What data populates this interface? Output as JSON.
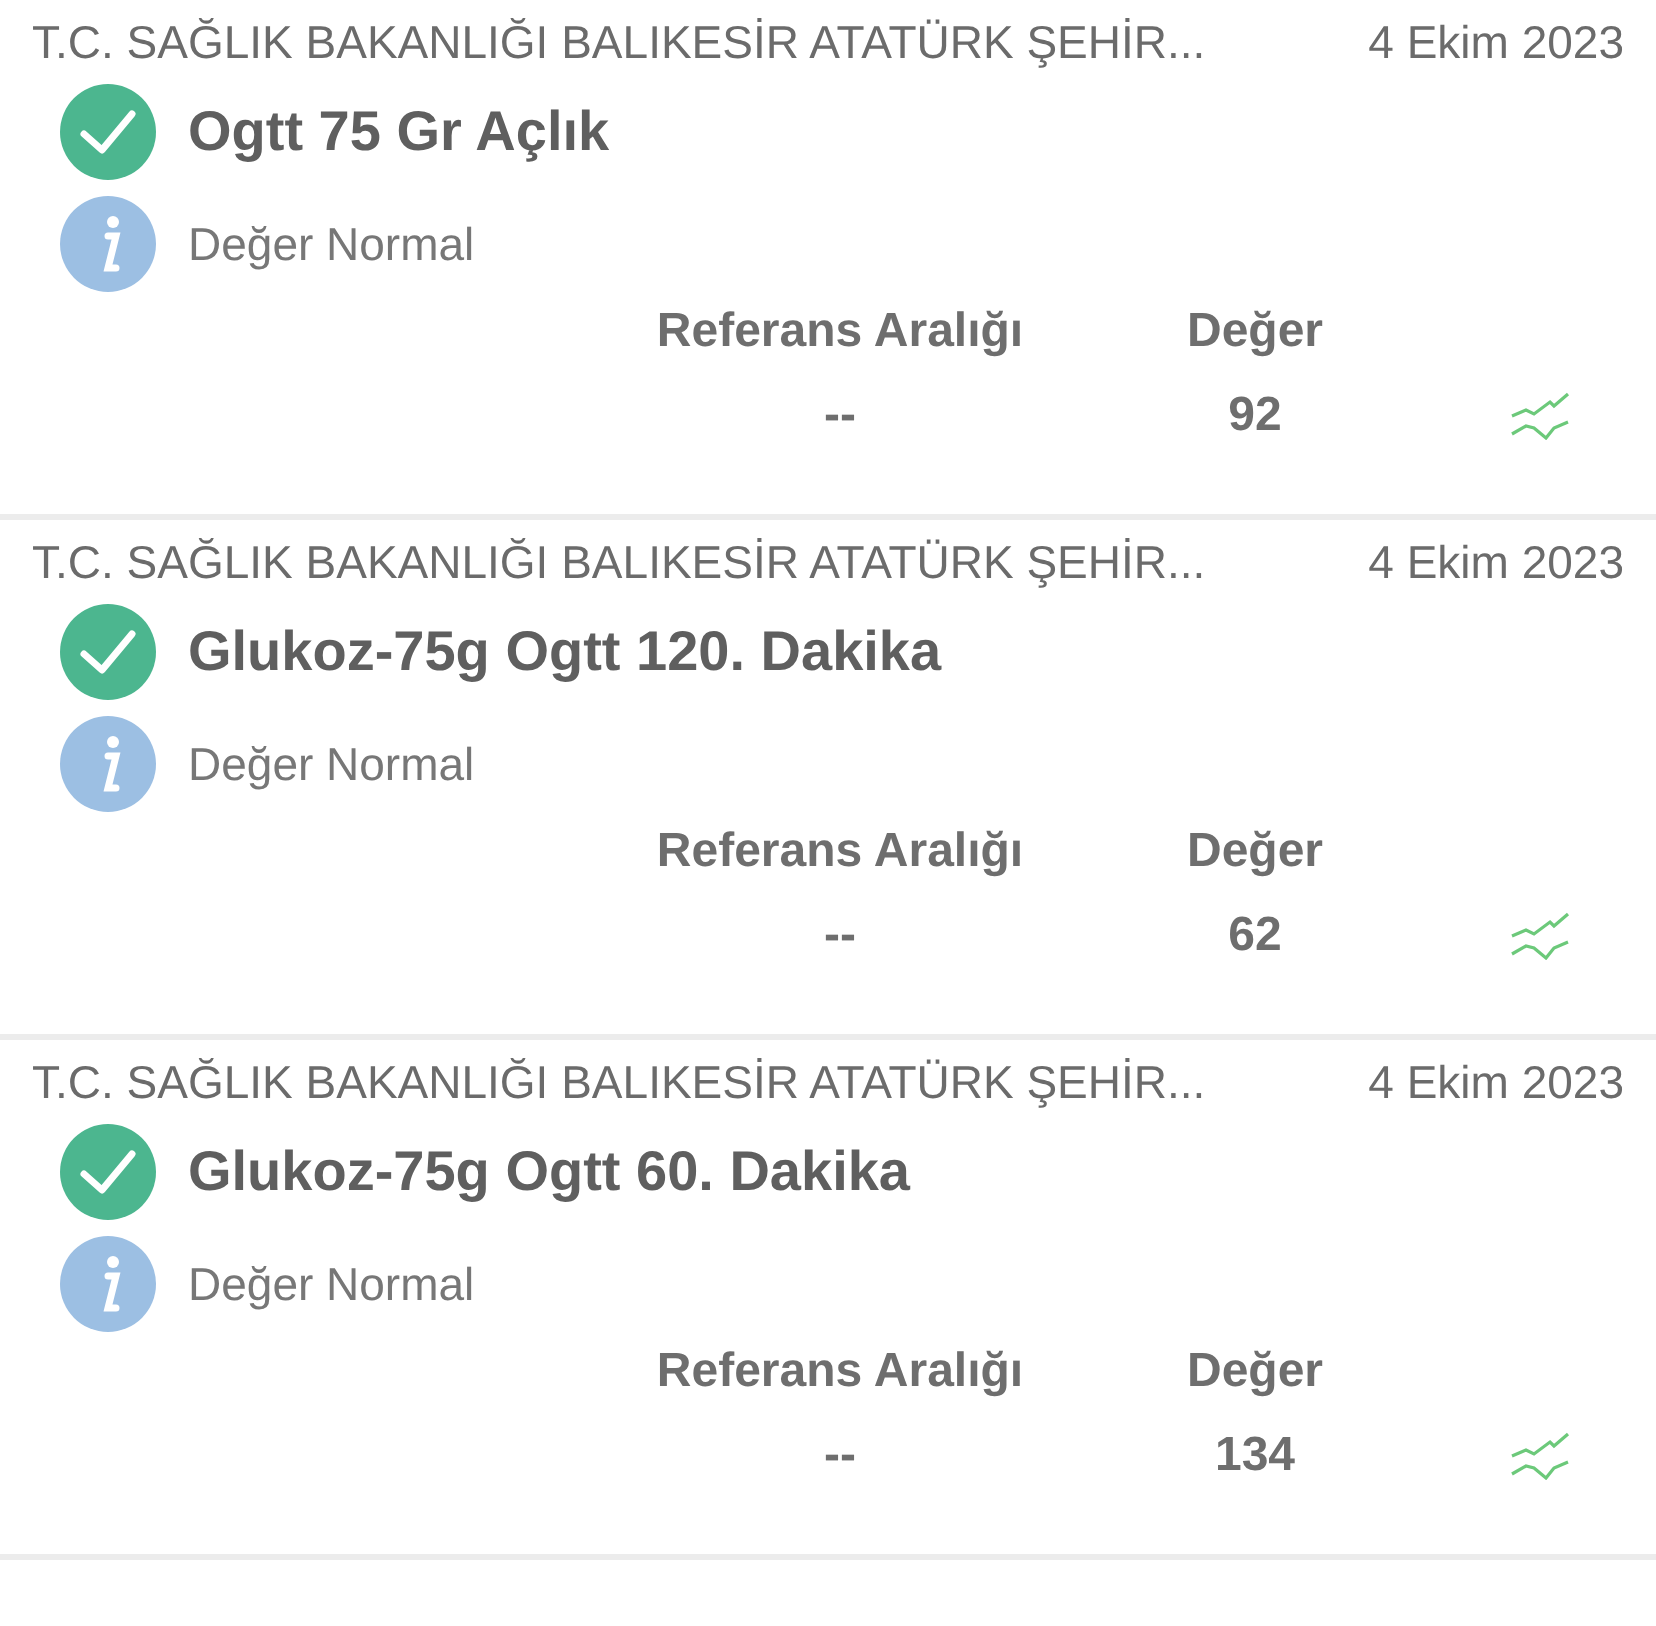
{
  "results": [
    {
      "hospital": "T.C. SAĞLIK BAKANLIĞI BALIKESİR ATATÜRK ŞEHİR...",
      "date": "4 Ekim 2023",
      "test": "Ogtt 75 Gr Açlık",
      "status": "Değer Normal",
      "reference_label": "Referans Aralığı",
      "value_label": "Değer",
      "reference": "--",
      "value": "92"
    },
    {
      "hospital": "T.C. SAĞLIK BAKANLIĞI BALIKESİR ATATÜRK ŞEHİR...",
      "date": "4 Ekim 2023",
      "test": "Glukoz-75g Ogtt 120. Dakika",
      "status": "Değer Normal",
      "reference_label": "Referans Aralığı",
      "value_label": "Değer",
      "reference": "--",
      "value": "62"
    },
    {
      "hospital": "T.C. SAĞLIK BAKANLIĞI BALIKESİR ATATÜRK ŞEHİR...",
      "date": "4 Ekim 2023",
      "test": "Glukoz-75g Ogtt 60. Dakika",
      "status": "Değer Normal",
      "reference_label": "Referans Aralığı",
      "value_label": "Değer",
      "reference": "--",
      "value": "134"
    }
  ]
}
